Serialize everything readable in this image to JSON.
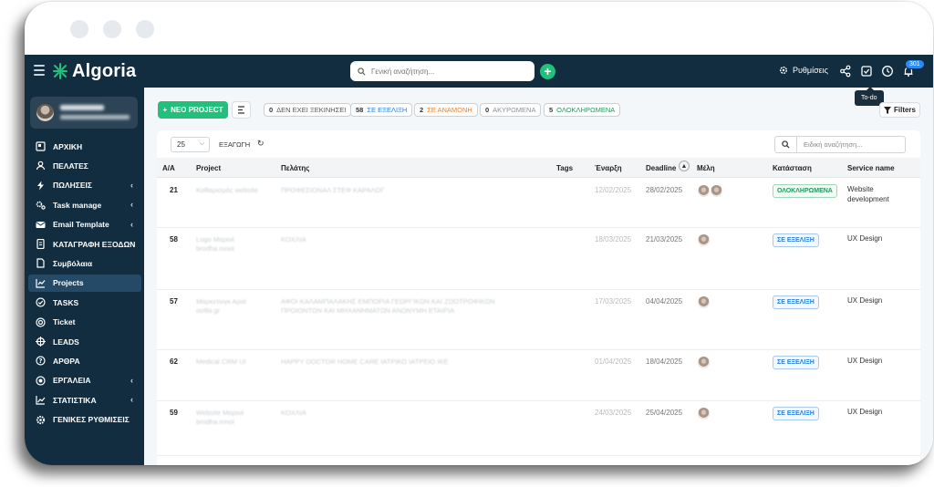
{
  "brand": {
    "name": "Algoria"
  },
  "topbar": {
    "search_placeholder": "Γενική αναζήτηση...",
    "settings_label": "Ρυθμίσεις",
    "notification_count": "301"
  },
  "tooltip": "To-do",
  "sidebar": {
    "items": [
      {
        "label": "ΑΡΧΙΚΗ",
        "icon": "dashboard-icon",
        "chevron": false
      },
      {
        "label": "ΠΕΛΑΤΕΣ",
        "icon": "user-icon",
        "chevron": false
      },
      {
        "label": "ΠΩΛΗΣΕΙΣ",
        "icon": "bolt-icon",
        "chevron": true
      },
      {
        "label": "Task manage",
        "icon": "gears-icon",
        "chevron": true
      },
      {
        "label": "Email Template",
        "icon": "envelope-icon",
        "chevron": true
      },
      {
        "label": "ΚΑΤΑΓΡΑΦΗ ΕΞΟΔΩΝ",
        "icon": "receipt-icon",
        "chevron": false
      },
      {
        "label": "Συμβόλαια",
        "icon": "document-icon",
        "chevron": false
      },
      {
        "label": "Projects",
        "icon": "chart-icon",
        "chevron": false,
        "active": true
      },
      {
        "label": "TASKS",
        "icon": "check-circle-icon",
        "chevron": false
      },
      {
        "label": "Ticket",
        "icon": "lifebuoy-icon",
        "chevron": false
      },
      {
        "label": "LEADS",
        "icon": "crosshair-icon",
        "chevron": false
      },
      {
        "label": "ΑΡΘΡΑ",
        "icon": "question-icon",
        "chevron": false
      },
      {
        "label": "ΕΡΓΑΛΕΙΑ",
        "icon": "dot-circle-icon",
        "chevron": true
      },
      {
        "label": "ΣΤΑΤΙΣΤΙΚΑ",
        "icon": "line-chart-icon",
        "chevron": true
      },
      {
        "label": "ΓΕΝΙΚΕΣ ΡΥΘΜΙΣΕΙΣ",
        "icon": "cog-icon",
        "chevron": false
      }
    ]
  },
  "toolbar": {
    "new_project_label": "ΝΕΟ PROJECT",
    "filters_label": "Filters",
    "status_chips": [
      {
        "count": "0",
        "label": "ΔΕΝ ΕΧΕΙ ΞΕΚΙΝΗΣΕΙ",
        "color": "#555555"
      },
      {
        "count": "58",
        "label": "ΣΕ ΕΞΕΛΙΞΗ",
        "color": "#2a7fd4"
      },
      {
        "count": "2",
        "label": "ΣΕ ΑΝΑΜΟΝΗ",
        "color": "#f0812a"
      },
      {
        "count": "0",
        "label": "ΑΚΥΡΩΜΕΝΑ",
        "color": "#8a9299"
      },
      {
        "count": "5",
        "label": "ΟΛΟΚΛΗΡΩΜΕΝΑ",
        "color": "#1f9a5a"
      }
    ]
  },
  "table_controls": {
    "page_size": "25",
    "export_label": "ΕΞΑΓΩΓΗ",
    "search_placeholder": "Ειδική αναζήτηση..."
  },
  "table": {
    "columns": [
      "Α/Α",
      "Project",
      "Πελάτης",
      "Tags",
      "Έναρξη",
      "Deadline",
      "Μέλη",
      "Κατάσταση",
      "Service name"
    ],
    "rows": [
      {
        "id": "21",
        "start": "12/02/2025",
        "deadline": "28/02/2025",
        "status": "ΟΛΟΚΛΗΡΩΜΕΝΑ",
        "status_kind": "done",
        "service": [
          "Website",
          "development"
        ],
        "members": 2
      },
      {
        "id": "58",
        "start": "18/03/2025",
        "deadline": "21/03/2025",
        "status": "ΣΕ ΕΞΕΛΙΞΗ",
        "status_kind": "prog",
        "service": [
          "UX Design"
        ],
        "members": 1
      },
      {
        "id": "57",
        "start": "17/03/2025",
        "deadline": "04/04/2025",
        "status": "ΣΕ ΕΞΕΛΙΞΗ",
        "status_kind": "prog",
        "service": [
          "UX Design"
        ],
        "members": 1
      },
      {
        "id": "62",
        "start": "01/04/2025",
        "deadline": "18/04/2025",
        "status": "ΣΕ ΕΞΕΛΙΞΗ",
        "status_kind": "prog",
        "service": [
          "UX Design"
        ],
        "members": 1
      },
      {
        "id": "59",
        "start": "24/03/2025",
        "deadline": "25/04/2025",
        "status": "ΣΕ ΕΞΕΛΙΞΗ",
        "status_kind": "prog",
        "service": [
          "UX Design"
        ],
        "members": 1
      }
    ]
  }
}
